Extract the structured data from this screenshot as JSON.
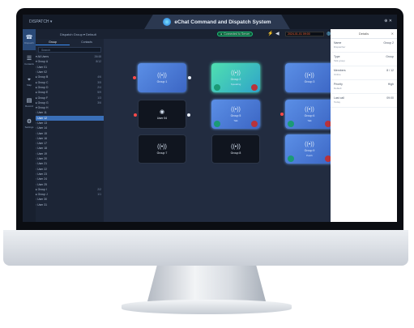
{
  "app": {
    "brand": "DISPATCH ▾",
    "title": "eChat Command and Dispatch System",
    "window_controls": "⊕ ✕"
  },
  "toolbar": {
    "group_label": "Dispatch Group ▾  Default",
    "status": "Connected to Server",
    "time": "2024-01-01 09:00"
  },
  "rail": [
    {
      "label": "Dispatch",
      "icon": "☎"
    },
    {
      "label": "Contacts",
      "icon": "☰"
    },
    {
      "label": "Map",
      "icon": "⌖"
    },
    {
      "label": "Record",
      "icon": "▤"
    },
    {
      "label": "Settings",
      "icon": "⚙"
    }
  ],
  "tree": {
    "tabs": [
      "Group",
      "Contacts"
    ],
    "search_placeholder": "Search",
    "rows": [
      {
        "label": "▾ All Users",
        "count": "26/48",
        "sel": false
      },
      {
        "label": "  ▾ Group A",
        "count": "8/12",
        "sel": false
      },
      {
        "label": "    ◦ User 01",
        "count": "",
        "sel": false
      },
      {
        "label": "    ◦ User 02",
        "count": "",
        "sel": false
      },
      {
        "label": "  ▸ Group B",
        "count": "4/6",
        "sel": false
      },
      {
        "label": "  ▸ Group C",
        "count": "3/5",
        "sel": false
      },
      {
        "label": "  ▸ Group D",
        "count": "2/4",
        "sel": false
      },
      {
        "label": "  ▸ Group E",
        "count": "5/9",
        "sel": false
      },
      {
        "label": "  ▸ Group F",
        "count": "1/3",
        "sel": false
      },
      {
        "label": "  ▸ Group G",
        "count": "3/6",
        "sel": false
      },
      {
        "label": "  ▾ Group H",
        "count": "",
        "sel": false
      },
      {
        "label": "    ◦ User 11",
        "count": "",
        "sel": false
      },
      {
        "label": "    ◦ User 12",
        "count": "",
        "sel": true
      },
      {
        "label": "    ◦ User 13",
        "count": "",
        "sel": false
      },
      {
        "label": "    ◦ User 14",
        "count": "",
        "sel": false
      },
      {
        "label": "    ◦ User 15",
        "count": "",
        "sel": false
      },
      {
        "label": "    ◦ User 16",
        "count": "",
        "sel": false
      },
      {
        "label": "    ◦ User 17",
        "count": "",
        "sel": false
      },
      {
        "label": "    ◦ User 18",
        "count": "",
        "sel": false
      },
      {
        "label": "    ◦ User 19",
        "count": "",
        "sel": false
      },
      {
        "label": "    ◦ User 20",
        "count": "",
        "sel": false
      },
      {
        "label": "    ◦ User 21",
        "count": "",
        "sel": false
      },
      {
        "label": "    ◦ User 22",
        "count": "",
        "sel": false
      },
      {
        "label": "    ◦ User 23",
        "count": "",
        "sel": false
      },
      {
        "label": "    ◦ User 24",
        "count": "",
        "sel": false
      },
      {
        "label": "    ◦ User 25",
        "count": "",
        "sel": false
      },
      {
        "label": "  ▸ Group I",
        "count": "2/2",
        "sel": false
      },
      {
        "label": "  ▸ Group J",
        "count": "1/1",
        "sel": false
      },
      {
        "label": "    ◦ User 30",
        "count": "",
        "sel": false
      },
      {
        "label": "    ◦ User 31",
        "count": "",
        "sel": false
      }
    ]
  },
  "nodes": [
    {
      "label": "Group 1",
      "sub": "",
      "style": "blue",
      "icon": "((•))",
      "ports": true,
      "buttons": false
    },
    {
      "label": "Group 2",
      "sub": "Speaking",
      "style": "green",
      "icon": "((•))",
      "ports": false,
      "buttons": true
    },
    {
      "label": "Group 3",
      "sub": "",
      "style": "blue",
      "icon": "((•))",
      "ports": false,
      "buttons": false
    },
    {
      "label": "User 04",
      "sub": "",
      "style": "dark",
      "icon": "◉",
      "ports": true,
      "buttons": false
    },
    {
      "label": "Group 5",
      "sub": "Talk",
      "style": "blue",
      "icon": "((•))",
      "ports": false,
      "buttons": true
    },
    {
      "label": "Group 6",
      "sub": "Talk",
      "style": "blue",
      "icon": "((•))",
      "ports": true,
      "buttons": true
    },
    {
      "label": "Group 7",
      "sub": "",
      "style": "dark",
      "icon": "((•))",
      "ports": false,
      "buttons": false
    },
    {
      "label": "Group 8",
      "sub": "",
      "style": "dark",
      "icon": "((•))",
      "ports": false,
      "buttons": false
    },
    {
      "label": "Group 9",
      "sub": "Patch",
      "style": "blue",
      "icon": "((•))",
      "ports": false,
      "buttons": true
    }
  ],
  "panel": {
    "title": "Details",
    "close": "✕",
    "rows": [
      {
        "key": "Name",
        "value_right": "Group 2",
        "value": "Dispatcher"
      },
      {
        "key": "Type",
        "value_right": "Group",
        "value": "Talk group"
      },
      {
        "key": "Members",
        "value_right": "8 / 12",
        "value": "Online"
      },
      {
        "key": "Priority",
        "value_right": "High",
        "value": "Default"
      },
      {
        "key": "Last call",
        "value_right": "09:00",
        "value": "Today"
      }
    ]
  }
}
